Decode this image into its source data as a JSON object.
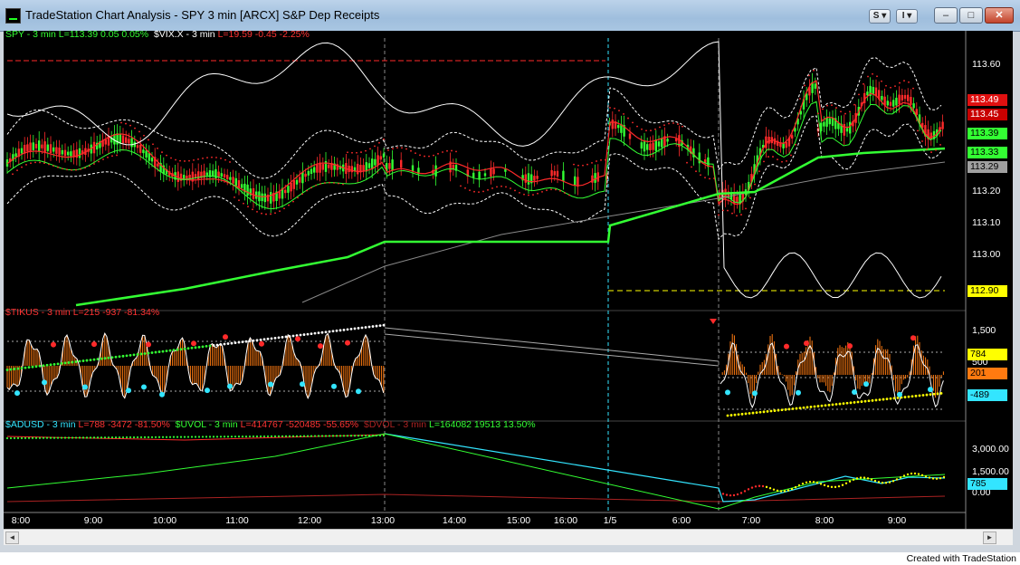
{
  "window": {
    "title": "TradeStation Chart Analysis - SPY 3 min [ARCX] S&P Dep Receipts",
    "btn_symbol": "S ▾",
    "btn_layout": "I ▾",
    "min_icon": "minimize-icon",
    "max_icon": "maximize-icon",
    "close_icon": "close-icon"
  },
  "colors": {
    "bg": "#000000",
    "green": "#33ff33",
    "red": "#ff2a2a",
    "white": "#ffffff",
    "cyan": "#33e5ff",
    "orange": "#ff7a10",
    "yellow": "#ffff00"
  },
  "panes": {
    "price": {
      "label_spy": "SPY - 3 min",
      "label_spy_vals": "L=113.39  0.05   0.05%",
      "label_vix": "$VIX.X - 3 min",
      "label_vix_vals": "L=19.59  -0.45  -2.25%",
      "axis": [
        "113.60",
        "113.50",
        "113.40",
        "113.30",
        "113.20",
        "113.10",
        "113.00"
      ],
      "boxes": [
        {
          "text": "113.49",
          "bg": "#e01010",
          "fg": "#ffffff"
        },
        {
          "text": "113.45",
          "bg": "#c80000",
          "fg": "#ffffff"
        },
        {
          "text": "113.39",
          "bg": "#33ff33",
          "fg": "#000000"
        },
        {
          "text": "113.33",
          "bg": "#33ff33",
          "fg": "#000000"
        },
        {
          "text": "113.29",
          "bg": "#a0a0a0",
          "fg": "#000000"
        },
        {
          "text": "112.90",
          "bg": "#ffff00",
          "fg": "#000000"
        }
      ]
    },
    "tikus": {
      "label": "$TIKUS - 3 min",
      "label_vals": "L=215    -937    -81.34%",
      "axis": [
        "1,500",
        "500"
      ],
      "boxes": [
        {
          "text": "784",
          "bg": "#ffff00",
          "fg": "#000000"
        },
        {
          "text": "201",
          "bg": "#ff7a10",
          "fg": "#000000"
        },
        {
          "text": "-489",
          "bg": "#33e5ff",
          "fg": "#000000"
        }
      ]
    },
    "adv": {
      "label_adusd": "$ADUSD - 3 min",
      "label_adusd_vals": "L=788  -3472  -81.50%",
      "label_uvol": "$UVOL - 3 min",
      "label_uvol_vals": "L=414767  -520485  -55.65%",
      "label_dvol": "$DVOL - 3 min",
      "label_dvol_vals": "L=164082  19513   13.50%",
      "axis": [
        "3,000.00",
        "1,500.00",
        "0.00"
      ],
      "boxes": [
        {
          "text": "785",
          "bg": "#33e5ff",
          "fg": "#000000"
        }
      ]
    }
  },
  "time_axis": [
    "8:00",
    "9:00",
    "10:00",
    "11:00",
    "12:00",
    "13:00",
    "14:00",
    "15:00",
    "16:00",
    "1/5",
    "6:00",
    "7:00",
    "8:00",
    "9:00"
  ],
  "footer": {
    "credit": "Created with TradeStation"
  },
  "scrollbar": {
    "left_arrow": "◄",
    "right_arrow": "►"
  }
}
